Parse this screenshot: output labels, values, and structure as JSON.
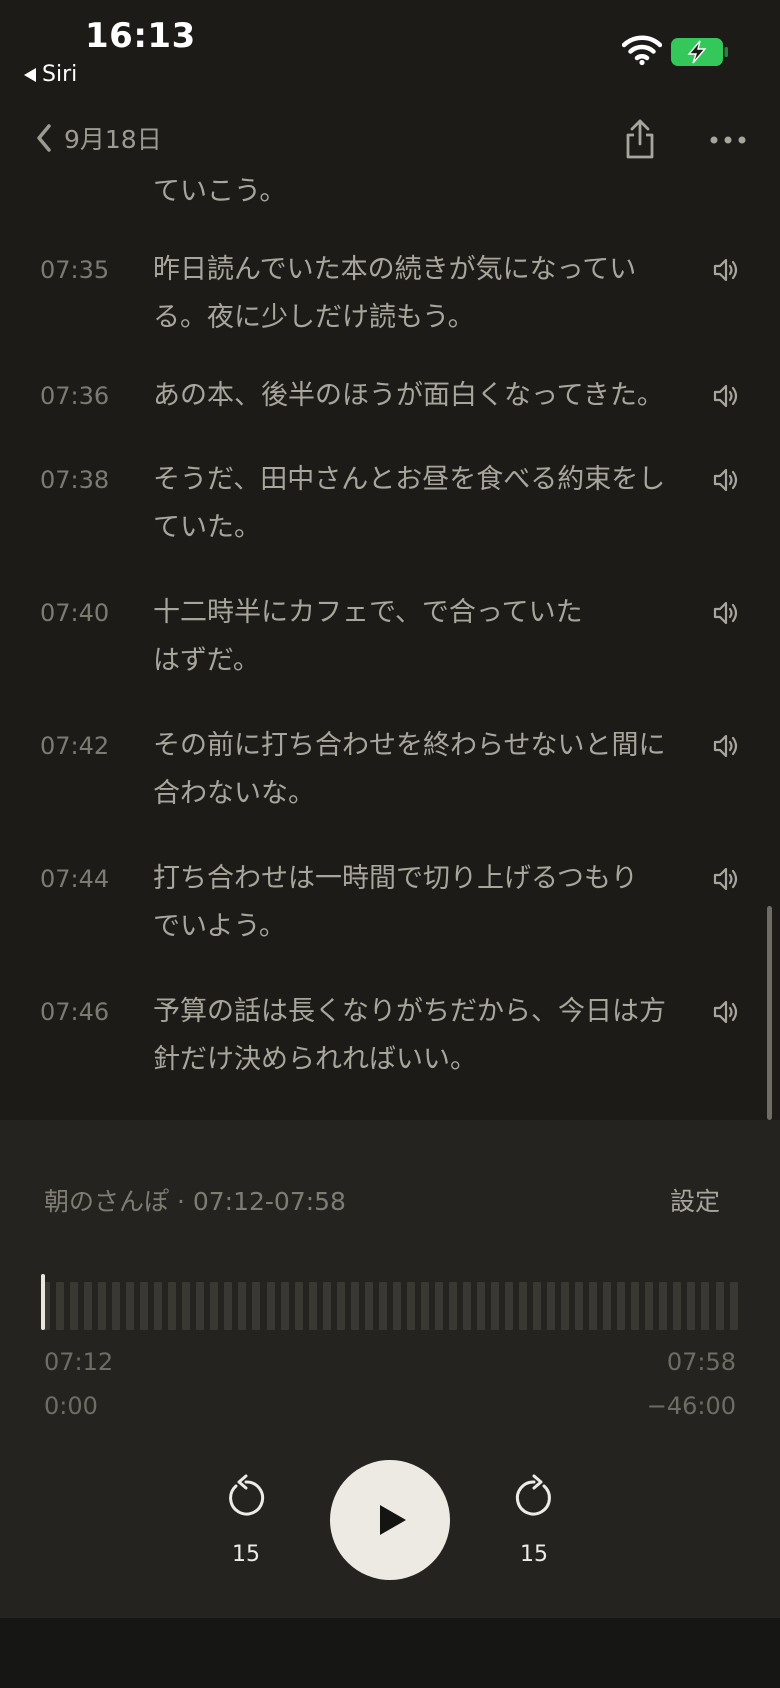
{
  "status_bar": {
    "time": "16:13",
    "back_app": "Siri"
  },
  "nav": {
    "back_label": "9月18日"
  },
  "transcript": {
    "partial_top": "ていこう。",
    "entries": [
      {
        "time": "07:35",
        "lines": [
          "昨日読んでいた本の続きが気になってい",
          "る。夜に少しだけ読もう。"
        ]
      },
      {
        "time": "07:36",
        "lines": [
          "あの本、後半のほうが面白くなってきた。"
        ]
      },
      {
        "time": "07:38",
        "lines": [
          "そうだ、田中さんとお昼を食べる約束をし",
          "ていた。"
        ]
      },
      {
        "time": "07:40",
        "lines": [
          "十二時半にカフェで、で合っていた",
          "はずだ。"
        ]
      },
      {
        "time": "07:42",
        "lines": [
          "その前に打ち合わせを終わらせないと間に",
          "合わないな。"
        ]
      },
      {
        "time": "07:44",
        "lines": [
          "打ち合わせは一時間で切り上げるつもり",
          "でいよう。"
        ]
      },
      {
        "time": "07:46",
        "lines": [
          "予算の話は長くなりがちだから、今日は方",
          "針だけ決められればいい。"
        ]
      }
    ]
  },
  "player": {
    "title": "朝のさんぽ · 07:12-07:58",
    "settings_label": "設定",
    "progress": 0,
    "start_clock": "07:12",
    "end_clock": "07:58",
    "elapsed": "0:00",
    "remaining": "−46:00",
    "skip_back_label": "15",
    "skip_forward_label": "15"
  },
  "colors": {
    "background": "#1c1b18",
    "player_background": "#24231f",
    "battery": "#34c759"
  }
}
